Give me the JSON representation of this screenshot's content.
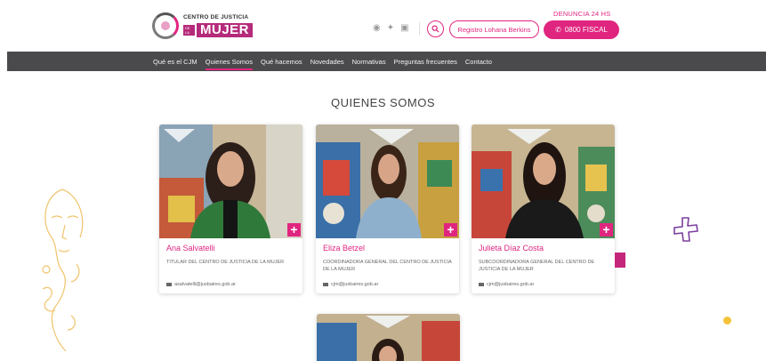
{
  "header": {
    "logo_top": "CENTRO DE JUSTICIA",
    "logo_sub": "DE LA",
    "logo_mujer": "MUJER",
    "denuncia_label": "DENUNCIA 24 HS",
    "registro_label": "Registro Lohana Berkins",
    "fiscal_label": "0800 FISCAL",
    "social_icons": [
      "facebook-icon",
      "twitter-icon",
      "instagram-icon"
    ]
  },
  "nav": {
    "items": [
      {
        "label": "Qué es el CJM"
      },
      {
        "label": "Quienes Somos",
        "active": true
      },
      {
        "label": "Qué hacemos"
      },
      {
        "label": "Novedades"
      },
      {
        "label": "Normativas"
      },
      {
        "label": "Preguntas frecuentes"
      },
      {
        "label": "Contacto"
      }
    ]
  },
  "section": {
    "title": "QUIENES SOMOS"
  },
  "people": [
    {
      "name": "Ana Salvatelli",
      "role": "TITULAR DEL CENTRO DE JUSTICIA DE LA MUJER",
      "email": "asalvatelli@jusbaires.gob.ar"
    },
    {
      "name": "Eliza Betzel",
      "role": "COORDINADORA GENERAL DEL CENTRO DE JUSTICIA DE LA MUJER",
      "email": "cjm@jusbaires.gob.ar"
    },
    {
      "name": "Julieta Díaz Costa",
      "role": "SUBCOORDINADORA GENERAL DEL CENTRO DE JUSTICIA DE LA MUJER",
      "email": "cjm@jusbaires.gob.ar"
    }
  ],
  "colors": {
    "accent": "#e0257f",
    "nav_bg": "#4a4a4c",
    "deco_yellow": "#f5c33b",
    "deco_purple": "#7b3fa0"
  }
}
